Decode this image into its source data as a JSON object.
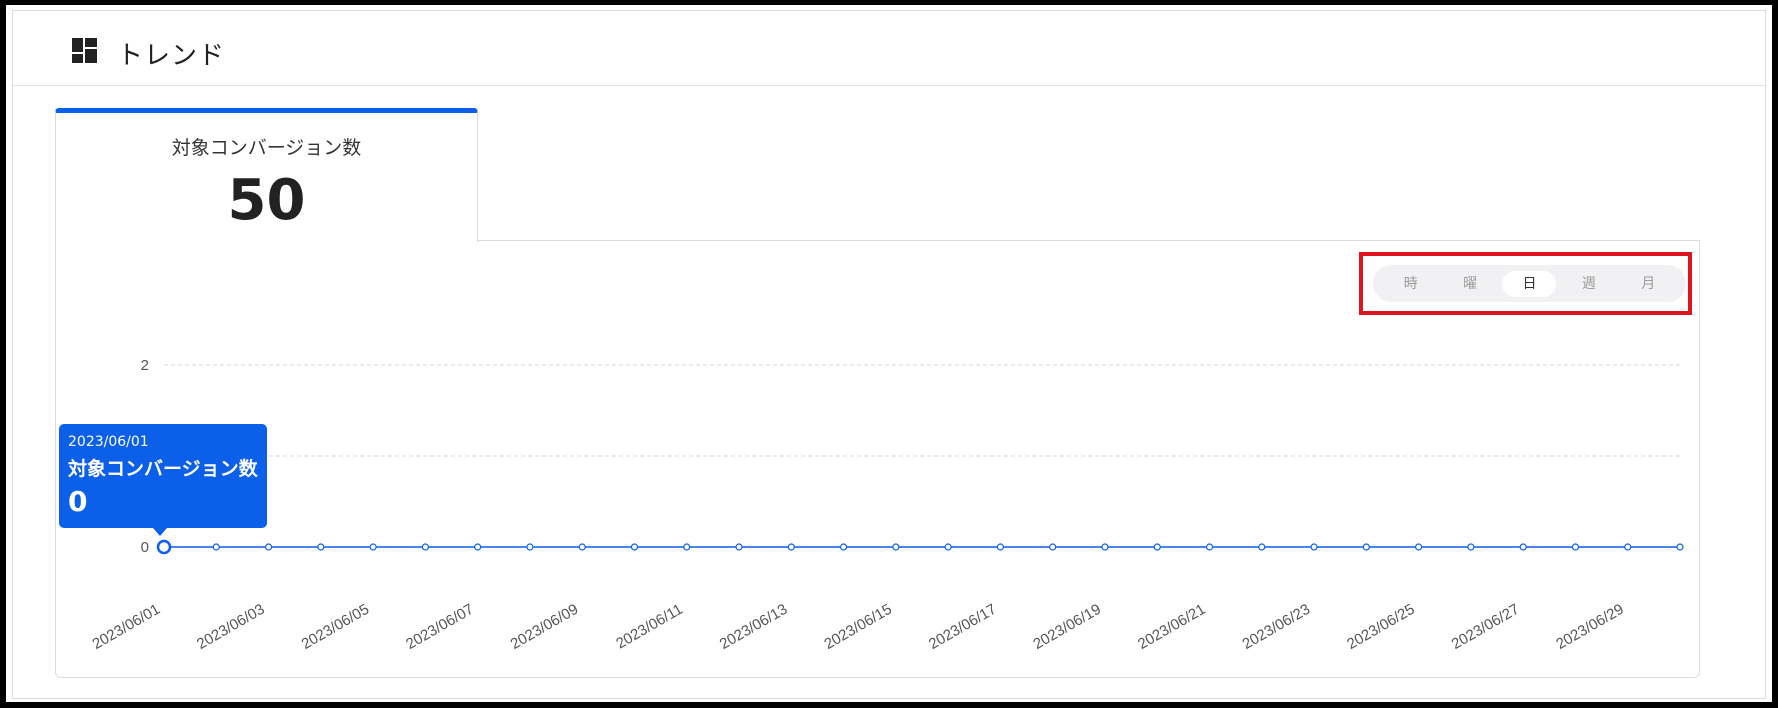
{
  "header": {
    "title": "トレンド",
    "icon": "dashboard-icon"
  },
  "tab": {
    "label": "対象コンバージョン数",
    "value": "50"
  },
  "granularity": {
    "options": [
      "時",
      "曜",
      "日",
      "週",
      "月"
    ],
    "selected": "日"
  },
  "colors": {
    "accent": "#0b5fe8",
    "highlight": "#e0141e"
  },
  "tooltip": {
    "date": "2023/06/01",
    "label": "対象コンバージョン数",
    "value": "0"
  },
  "chart_data": {
    "type": "line",
    "x": [
      "2023/06/01",
      "2023/06/02",
      "2023/06/03",
      "2023/06/04",
      "2023/06/05",
      "2023/06/06",
      "2023/06/07",
      "2023/06/08",
      "2023/06/09",
      "2023/06/10",
      "2023/06/11",
      "2023/06/12",
      "2023/06/13",
      "2023/06/14",
      "2023/06/15",
      "2023/06/16",
      "2023/06/17",
      "2023/06/18",
      "2023/06/19",
      "2023/06/20",
      "2023/06/21",
      "2023/06/22",
      "2023/06/23",
      "2023/06/24",
      "2023/06/25",
      "2023/06/26",
      "2023/06/27",
      "2023/06/28",
      "2023/06/29",
      "2023/06/30"
    ],
    "series": [
      {
        "values": [
          0,
          0,
          0,
          0,
          0,
          0,
          0,
          0,
          0,
          0,
          0,
          0,
          0,
          0,
          0,
          0,
          0,
          0,
          0,
          0,
          0,
          0,
          0,
          0,
          0,
          0,
          0,
          0,
          0,
          0
        ]
      }
    ],
    "x_tick_labels": [
      "2023/06/01",
      "2023/06/03",
      "2023/06/05",
      "2023/06/07",
      "2023/06/09",
      "2023/06/11",
      "2023/06/13",
      "2023/06/15",
      "2023/06/17",
      "2023/06/19",
      "2023/06/21",
      "2023/06/23",
      "2023/06/25",
      "2023/06/27",
      "2023/06/29"
    ],
    "y_tick_labels": [
      "0",
      "2"
    ],
    "ylim": [
      0,
      2
    ],
    "grid": true,
    "xlabel": "",
    "ylabel": ""
  }
}
